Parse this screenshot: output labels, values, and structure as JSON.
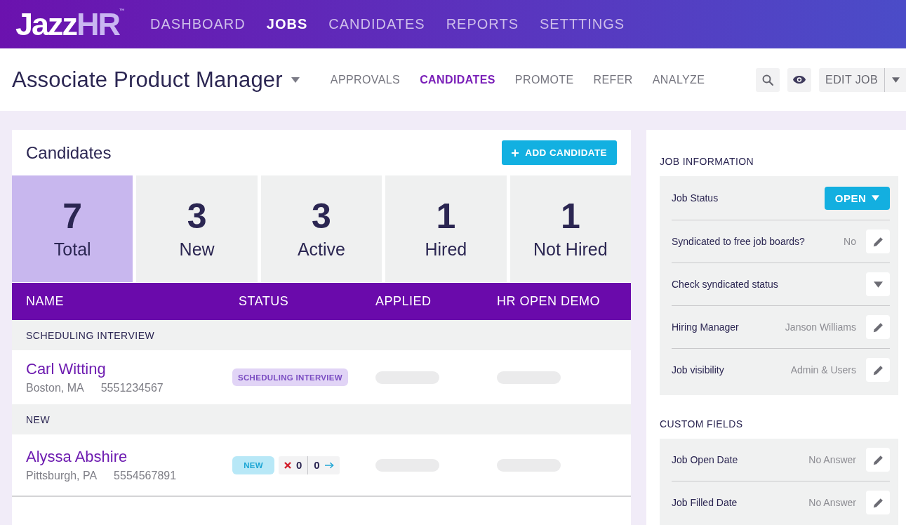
{
  "top_nav": {
    "logo": {
      "text": "Jazz",
      "accent": "HR",
      "mark": "™"
    },
    "items": [
      {
        "label": "DASHBOARD",
        "selected": false
      },
      {
        "label": "JOBS",
        "selected": true
      },
      {
        "label": "CANDIDATES",
        "selected": false
      },
      {
        "label": "REPORTS",
        "selected": false
      },
      {
        "label": "SETTTINGS",
        "selected": false
      }
    ]
  },
  "job_header": {
    "title": "Associate Product Manager",
    "tabs": [
      {
        "label": "APPROVALS",
        "selected": false
      },
      {
        "label": "CANDIDATES",
        "selected": true
      },
      {
        "label": "PROMOTE",
        "selected": false
      },
      {
        "label": "REFER",
        "selected": false
      },
      {
        "label": "ANALYZE",
        "selected": false
      }
    ],
    "edit_button": "EDIT JOB"
  },
  "candidates_panel": {
    "title": "Candidates",
    "add_button": "ADD CANDIDATE",
    "stats": [
      {
        "count": "7",
        "label": "Total",
        "selected": true
      },
      {
        "count": "3",
        "label": "New",
        "selected": false
      },
      {
        "count": "3",
        "label": "Active",
        "selected": false
      },
      {
        "count": "1",
        "label": "Hired",
        "selected": false
      },
      {
        "count": "1",
        "label": "Not Hired",
        "selected": false
      }
    ],
    "table": {
      "columns": [
        "NAME",
        "STATUS",
        "APPLIED",
        "HR OPEN DEMO"
      ],
      "groups": [
        {
          "title": "SCHEDULING INTERVIEW",
          "rows": [
            {
              "name": "Carl Witting",
              "location": "Boston, MA",
              "phone": "5551234567",
              "status": {
                "label": "SCHEDULING INTERVIEW",
                "kind": "scheduling"
              },
              "loading": true
            }
          ]
        },
        {
          "title": "NEW",
          "rows": [
            {
              "name": "Alyssa Abshire",
              "location": "Pittsburgh, PA",
              "phone": "5554567891",
              "status": {
                "label": "NEW",
                "kind": "new"
              },
              "votes": {
                "rejected": "0",
                "advanced": "0"
              },
              "loading": true
            }
          ]
        }
      ]
    }
  },
  "job_information": {
    "title": "JOB INFORMATION",
    "fields": [
      {
        "label": "Job Status",
        "kind": "status",
        "value": "OPEN"
      },
      {
        "label": "Syndicated to free job boards?",
        "kind": "edit",
        "value": "No"
      },
      {
        "label": "Check syndicated status",
        "kind": "expand"
      },
      {
        "label": "Hiring Manager",
        "kind": "edit",
        "value": "Janson Williams"
      },
      {
        "label": "Job visibility",
        "kind": "edit",
        "value": "Admin & Users"
      }
    ]
  },
  "custom_fields": {
    "title": "CUSTOM FIELDS",
    "fields": [
      {
        "label": "Job Open Date",
        "kind": "edit",
        "value": "No Answer"
      },
      {
        "label": "Job Filled Date",
        "kind": "edit",
        "value": "No Answer"
      }
    ]
  }
}
